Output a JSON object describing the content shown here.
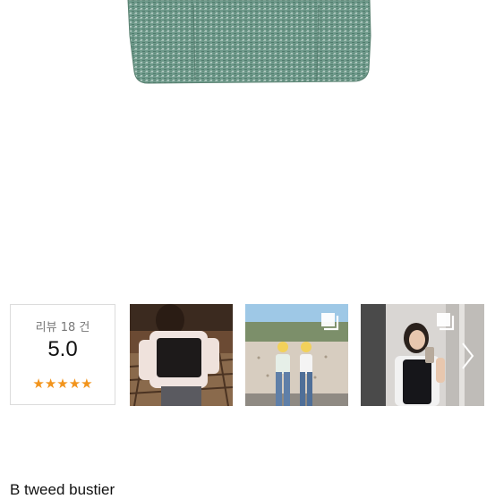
{
  "reviews": {
    "count_label": "리뷰 18 건",
    "rating": "5.0",
    "stars": "★★★★★",
    "star_color": "#f2941c"
  },
  "product": {
    "title": "B tweed bustier",
    "fabric_color": "#6f9a8b"
  },
  "thumbnails": [
    {
      "name": "review-photo-1",
      "has_multi_icon": false
    },
    {
      "name": "review-photo-2",
      "has_multi_icon": true
    },
    {
      "name": "review-photo-3",
      "has_multi_icon": true
    }
  ],
  "icons": {
    "multi_photo": "multi-photo-icon",
    "next": "chevron-right-icon"
  }
}
